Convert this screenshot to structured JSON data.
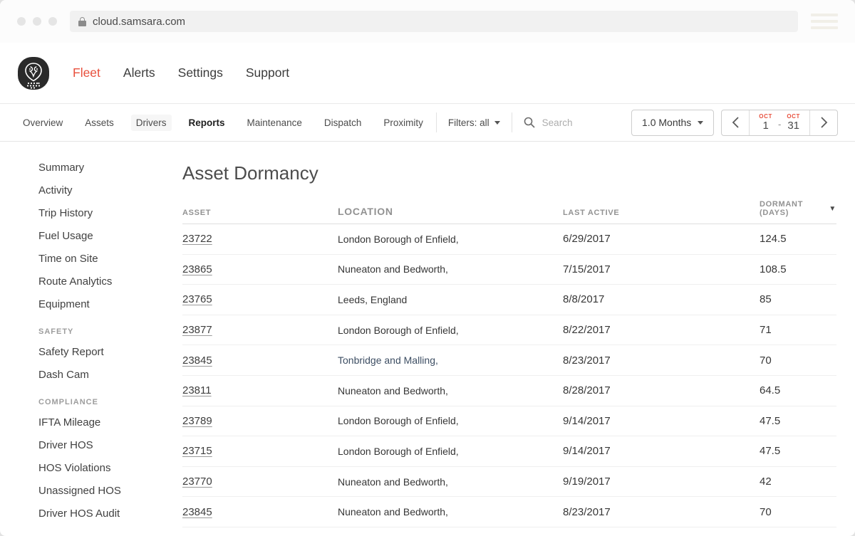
{
  "browser": {
    "url": "cloud.samsara.com"
  },
  "header": {
    "nav": [
      {
        "label": "Fleet",
        "active": true
      },
      {
        "label": "Alerts",
        "active": false
      },
      {
        "label": "Settings",
        "active": false
      },
      {
        "label": "Support",
        "active": false
      }
    ]
  },
  "toolbar": {
    "tabs": [
      "Overview",
      "Assets",
      "Drivers",
      "Reports",
      "Maintenance",
      "Dispatch",
      "Proximity"
    ],
    "active_tab": "Reports",
    "filters_label": "Filters: all",
    "search_placeholder": "Search",
    "range_button_label": "1.0 Months",
    "date_range": {
      "start_month": "OCT",
      "start_day": "1",
      "dash": "-",
      "end_month": "OCT",
      "end_day": "31"
    }
  },
  "sidebar": {
    "groups": [
      {
        "header": "",
        "items": [
          "Summary",
          "Activity",
          "Trip History",
          "Fuel Usage",
          "Time on Site",
          "Route Analytics",
          "Equipment"
        ]
      },
      {
        "header": "SAFETY",
        "items": [
          "Safety Report",
          "Dash Cam"
        ]
      },
      {
        "header": "COMPLIANCE",
        "items": [
          "IFTA Mileage",
          "Driver HOS",
          "HOS Violations",
          "Unassigned HOS",
          "Driver HOS Audit"
        ]
      }
    ]
  },
  "report": {
    "title": "Asset Dormancy",
    "columns": {
      "asset": "ASSET",
      "location": "LOCATION",
      "last_active": "LAST ACTIVE",
      "dormant": "DORMANT (DAYS)"
    },
    "sort": {
      "column": "DORMANT (DAYS)",
      "direction": "desc",
      "icon": "▼"
    },
    "rows": [
      {
        "asset": "23722",
        "location": "London Borough of Enfield,",
        "last_active": "6/29/2017",
        "dormant": "124.5",
        "location_highlight": false
      },
      {
        "asset": "23865",
        "location": "Nuneaton and Bedworth,",
        "last_active": "7/15/2017",
        "dormant": "108.5",
        "location_highlight": false
      },
      {
        "asset": "23765",
        "location": "Leeds, England",
        "last_active": "8/8/2017",
        "dormant": "85",
        "location_highlight": false
      },
      {
        "asset": "23877",
        "location": "London Borough of Enfield,",
        "last_active": "8/22/2017",
        "dormant": "71",
        "location_highlight": false
      },
      {
        "asset": "23845",
        "location": "Tonbridge and Malling,",
        "last_active": "8/23/2017",
        "dormant": "70",
        "location_highlight": true
      },
      {
        "asset": "23811",
        "location": "Nuneaton and Bedworth,",
        "last_active": "8/28/2017",
        "dormant": "64.5",
        "location_highlight": false
      },
      {
        "asset": "23789",
        "location": "London Borough of Enfield,",
        "last_active": "9/14/2017",
        "dormant": "47.5",
        "location_highlight": false
      },
      {
        "asset": "23715",
        "location": "London Borough of Enfield,",
        "last_active": "9/14/2017",
        "dormant": "47.5",
        "location_highlight": false
      },
      {
        "asset": "23770",
        "location": "Nuneaton and Bedworth,",
        "last_active": "9/19/2017",
        "dormant": "42",
        "location_highlight": false
      },
      {
        "asset": "23845",
        "location": "Nuneaton and Bedworth,",
        "last_active": "8/23/2017",
        "dormant": "70",
        "location_highlight": false
      }
    ]
  },
  "colors": {
    "accent": "#e8503d",
    "text_dark": "#3c3c3c",
    "text_muted": "#929292",
    "border": "#e9e9e9",
    "location_highlight": "#3d4e63"
  }
}
